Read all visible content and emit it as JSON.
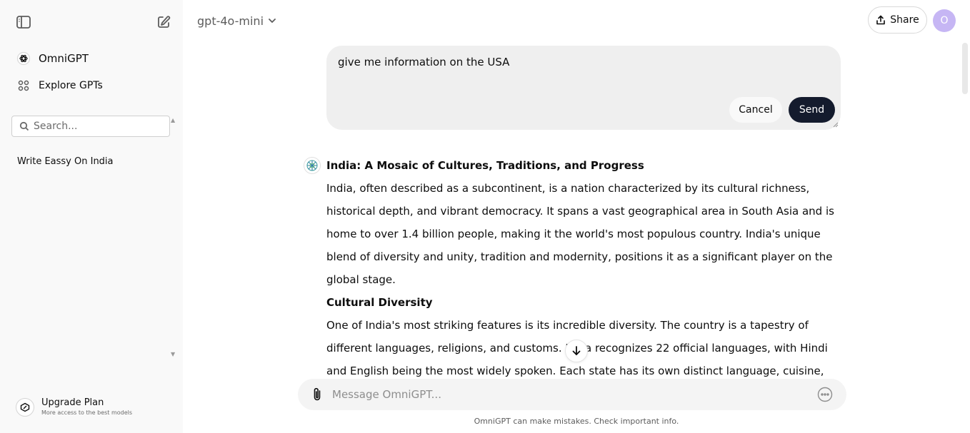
{
  "sidebar": {
    "nav": [
      {
        "label": "OmniGPT",
        "icon": "openai-logo-icon"
      },
      {
        "label": "Explore GPTs",
        "icon": "grid-icon"
      }
    ],
    "search": {
      "placeholder": "Search..."
    },
    "history": [
      {
        "label": "Write Eassy On India"
      }
    ],
    "upgrade": {
      "title": "Upgrade Plan",
      "subtitle": "More access to the best models"
    }
  },
  "header": {
    "model": "gpt-4o-mini",
    "share_label": "Share",
    "avatar_initial": "O"
  },
  "edit": {
    "value": "give me information on the USA",
    "cancel_label": "Cancel",
    "send_label": "Send"
  },
  "message": {
    "title": "India: A Mosaic of Cultures, Traditions, and Progress",
    "intro": "India, often described as a subcontinent, is a nation characterized by its cultural richness, historical depth, and vibrant democracy. It spans a vast geographical area in South Asia and is home to over 1.4 billion people, making it the world's most populous country. India's unique blend of diversity and unity, tradition and modernity, positions it as a significant player on the global stage.",
    "section_title": "Cultural Diversity",
    "section_body": "One of India's most striking features is its incredible diversity. The country is a tapestry of different languages, religions, and customs. India recognizes 22 official languages, with Hindi and English being the most widely spoken. Each state has its own distinct language, cuisine,"
  },
  "composer": {
    "placeholder": "Message OmniGPT...",
    "disclaimer": "OmniGPT can make mistakes. Check important info."
  },
  "colors": {
    "sidebar_bg": "#f9f9f9",
    "send_bg": "#141b2d",
    "avatar_bg": "#c6b6f4",
    "edit_bg": "#efefef"
  }
}
